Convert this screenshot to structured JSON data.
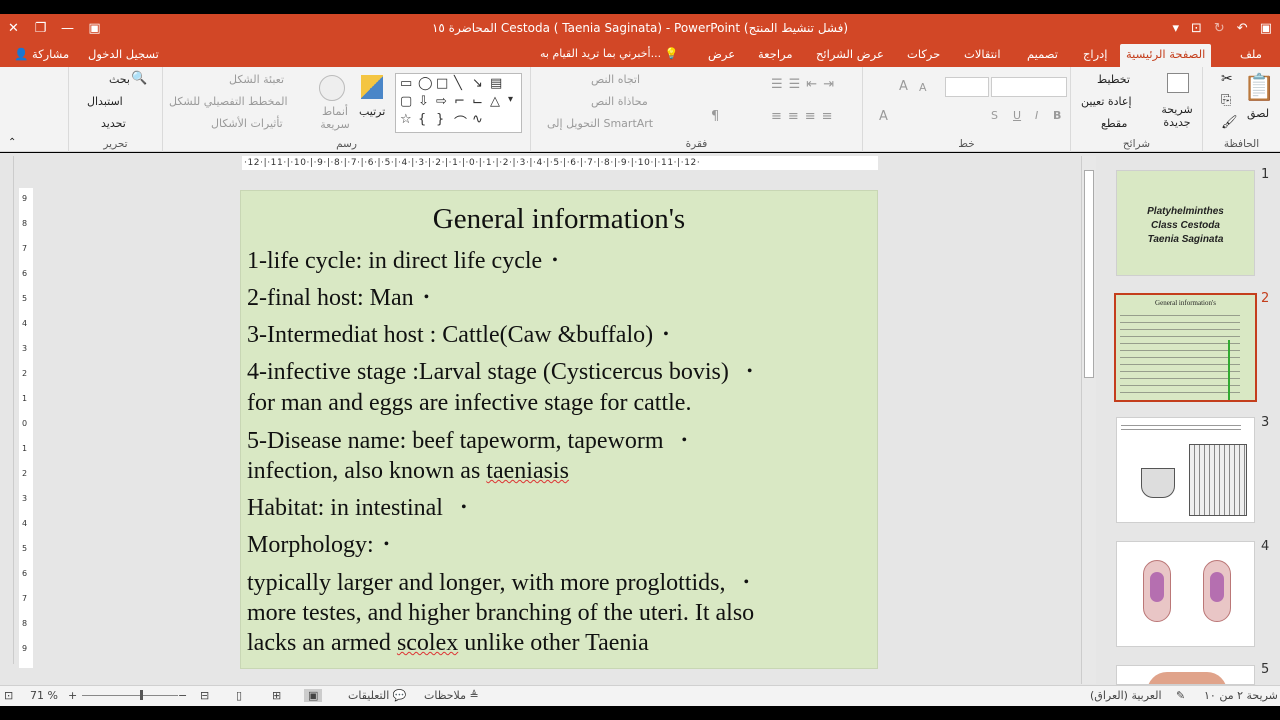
{
  "window": {
    "title": "المحاضرة ١٥ Cestoda ( Taenia Saginata) - PowerPoint (فشل تنشيط المنتج)",
    "close_glyph": "✕",
    "restore_glyph": "❐",
    "minimize_glyph": "—",
    "ribbon_display_glyph": "▣"
  },
  "tabs": {
    "items": [
      {
        "label": "ملف"
      },
      {
        "label": "الصفحة الرئيسية"
      },
      {
        "label": "إدراج"
      },
      {
        "label": "تصميم"
      },
      {
        "label": "انتقالات"
      },
      {
        "label": "حركات"
      },
      {
        "label": "عرض الشرائح"
      },
      {
        "label": "مراجعة"
      },
      {
        "label": "عرض"
      }
    ],
    "tell_me": "أخبرني بما تريد القيام به...",
    "sign_in": "تسجيل الدخول",
    "share": "مشاركة"
  },
  "ribbon": {
    "clipboard": {
      "paste": "لصق",
      "label": "الحافظة"
    },
    "slides": {
      "new_slide": "شريحة جديدة",
      "layout": "تخطيط",
      "reset": "إعادة تعيين",
      "section": "مقطع",
      "label": "شرائح"
    },
    "font": {
      "label": "خط",
      "bold": "B",
      "italic": "I",
      "underline": "U",
      "shadow": "S",
      "grow": "A",
      "shrink": "A"
    },
    "paragraph": {
      "text_direction": "اتجاه النص",
      "align_text": "محاذاة النص",
      "smartart": "التحويل إلى SmartArt",
      "label": "فقرة"
    },
    "drawing": {
      "arrange": "ترتيب",
      "quick_styles": "أنماط سريعة",
      "shape_fill": "تعبئة الشكل",
      "shape_outline": "المخطط التفصيلي للشكل",
      "shape_effects": "تأثيرات الأشكال",
      "label": "رسم"
    },
    "editing": {
      "find": "بحث",
      "replace": "استبدال",
      "select": "تحديد",
      "label": "تحرير"
    }
  },
  "ruler": {
    "horizontal": "·12·|·11·|·10·|·9·|·8·|·7·|·6·|·5·|·4·|·3·|·2·|·1·|·0·|·1·|·2·|·3·|·4·|·5·|·6·|·7·|·8·|·9·|·10·|·11·|·12·",
    "vertical": [
      "9",
      "8",
      "7",
      "6",
      "5",
      "4",
      "3",
      "2",
      "1",
      "0",
      "1",
      "2",
      "3",
      "4",
      "5",
      "6",
      "7",
      "8",
      "9"
    ]
  },
  "slide": {
    "title": "General information's",
    "bullet": "•",
    "lines": [
      "1-life cycle: in direct life cycle",
      "2-final host: Man",
      "3-Intermediat host : Cattle(Caw &buffalo)",
      "4-infective stage :Larval stage (Cysticercus bovis)",
      "for man and eggs are infective stage for cattle.",
      "5-Disease name: beef tapeworm, tapeworm",
      "infection, also known as ",
      "taeniasis",
      "Habitat: in intestinal",
      "Morphology:",
      "typically larger and longer, with more proglottids,",
      "more testes, and higher branching of the uteri. It also",
      "lacks an armed ",
      "scolex",
      " unlike other Taenia"
    ]
  },
  "thumbnails": [
    {
      "number": "1",
      "text": [
        "Platyhelminthes",
        "Class Cestoda",
        "Taenia Saginata"
      ]
    },
    {
      "number": "2",
      "text": "General information's"
    },
    {
      "number": "3"
    },
    {
      "number": "4"
    },
    {
      "number": "5"
    }
  ],
  "status": {
    "slide_of": "شريحة ٢ من ١٠",
    "language": "العربية (العراق)",
    "notes": "ملاحظات",
    "comments": "التعليقات",
    "zoom": "71 %"
  }
}
